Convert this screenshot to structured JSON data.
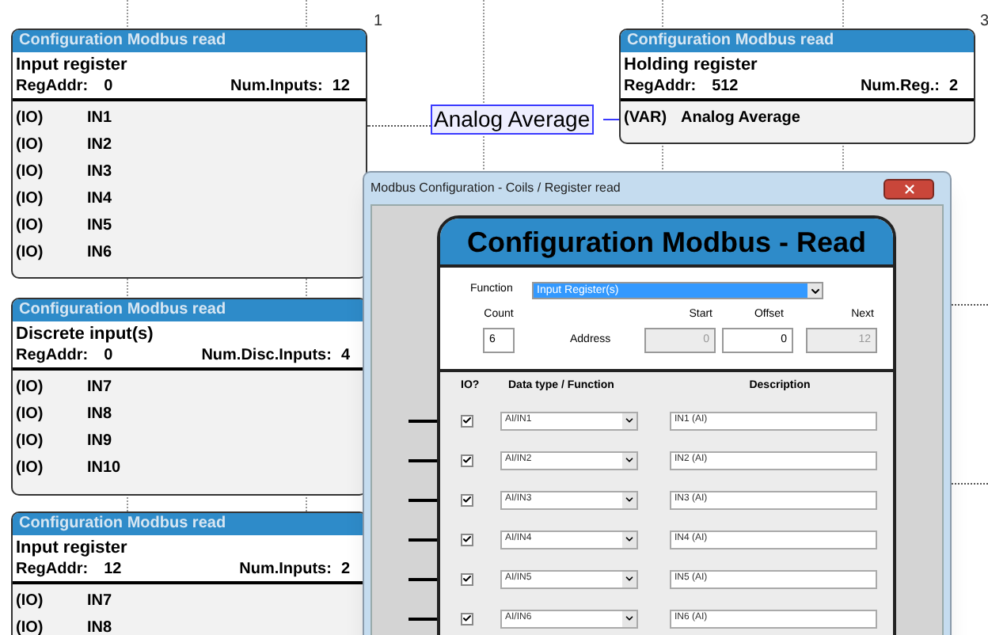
{
  "page_numbers": [
    "1",
    "3"
  ],
  "blocks": [
    {
      "header": "Configuration Modbus read",
      "type_label": "Input register",
      "reg_addr_label": "RegAddr:",
      "reg_addr": "0",
      "count_label": "Num.Inputs:",
      "count": "12",
      "rows": [
        {
          "prefix": "(IO)",
          "name": "IN1"
        },
        {
          "prefix": "(IO)",
          "name": "IN2"
        },
        {
          "prefix": "(IO)",
          "name": "IN3"
        },
        {
          "prefix": "(IO)",
          "name": "IN4"
        },
        {
          "prefix": "(IO)",
          "name": "IN5"
        },
        {
          "prefix": "(IO)",
          "name": "IN6"
        }
      ]
    },
    {
      "header": "Configuration Modbus read",
      "type_label": "Holding register",
      "reg_addr_label": "RegAddr:",
      "reg_addr": "512",
      "count_label": "Num.Reg.:",
      "count": "2",
      "rows": [
        {
          "prefix": "(VAR)",
          "name": "Analog Average"
        }
      ]
    },
    {
      "header": "Configuration Modbus read",
      "type_label": "Discrete input(s)",
      "reg_addr_label": "RegAddr:",
      "reg_addr": "0",
      "count_label": "Num.Disc.Inputs:",
      "count": "4",
      "rows": [
        {
          "prefix": "(IO)",
          "name": "IN7"
        },
        {
          "prefix": "(IO)",
          "name": "IN8"
        },
        {
          "prefix": "(IO)",
          "name": "IN9"
        },
        {
          "prefix": "(IO)",
          "name": "IN10"
        }
      ]
    },
    {
      "header": "Configuration Modbus read",
      "type_label": "Input register",
      "reg_addr_label": "RegAddr:",
      "reg_addr": "12",
      "count_label": "Num.Inputs:",
      "count": "2",
      "rows": [
        {
          "prefix": "(IO)",
          "name": "IN7"
        },
        {
          "prefix": "(IO)",
          "name": "IN8"
        }
      ]
    }
  ],
  "variable_label": "Analog Average",
  "dialog": {
    "title": "Modbus Configuration - Coils / Register read",
    "header": "Configuration Modbus - Read",
    "function_label": "Function",
    "function_value": "Input Register(s)",
    "count_label": "Count",
    "count_value": "6",
    "address_label": "Address",
    "start_label": "Start",
    "start_value": "0",
    "start_disabled": true,
    "offset_label": "Offset",
    "offset_value": "0",
    "offset_disabled": false,
    "next_label": "Next",
    "next_value": "12",
    "next_disabled": true,
    "columns": [
      "IO?",
      "Data type / Function",
      "Description"
    ],
    "rows": [
      {
        "checked": true,
        "data_type": "AI/IN1",
        "description": "IN1 (AI)"
      },
      {
        "checked": true,
        "data_type": "AI/IN2",
        "description": "IN2 (AI)"
      },
      {
        "checked": true,
        "data_type": "AI/IN3",
        "description": "IN3 (AI)"
      },
      {
        "checked": true,
        "data_type": "AI/IN4",
        "description": "IN4 (AI)"
      },
      {
        "checked": true,
        "data_type": "AI/IN5",
        "description": "IN5 (AI)"
      },
      {
        "checked": true,
        "data_type": "AI/IN6",
        "description": "IN6 (AI)"
      }
    ]
  }
}
